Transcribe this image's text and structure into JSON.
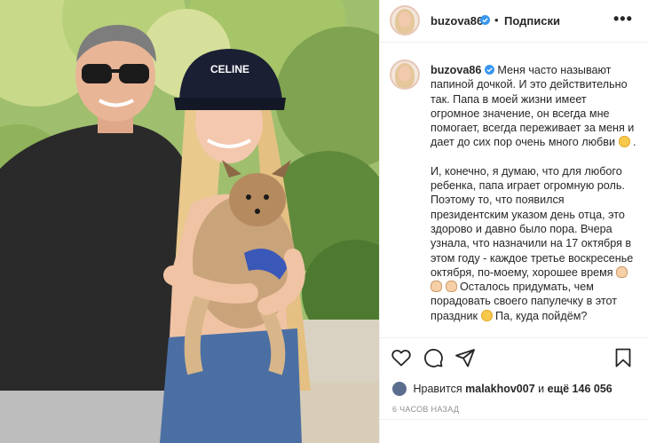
{
  "header": {
    "username": "buzova86",
    "separator": "•",
    "follow_label": "Подписки",
    "more_label": "•••"
  },
  "caption": {
    "username": "buzova86",
    "paragraph1": "Меня часто называют папиной дочкой. И это действительно так. Папа в моей жизни имеет огромное значение, он всегда мне помогает, всегда переживает за меня и дает до сих пор очень много любви",
    "paragraph1_end": ".",
    "paragraph2": "И, конечно, я думаю, что для любого ребенка, папа играет огромную роль. Поэтому то, что появился президентским указом день отца, это здорово и давно было пора. Вчера узнала, что назначили на 17 октября в этом году - каждое третье воскресенье октября, по-моему, хорошее время",
    "paragraph2_tail": "Осталось придумать, чем порадовать своего папулечку в этот праздник",
    "paragraph2_end": "Па, куда пойдём?"
  },
  "likes": {
    "prefix": "Нравится",
    "user": "malakhov007",
    "middle": "и",
    "count": "ещё 146 056"
  },
  "timestamp": "6 ЧАСОВ НАЗАД",
  "photo": {
    "cap_text": "CELINE"
  },
  "colors": {
    "verified": "#3897f0",
    "text": "#262626",
    "muted": "#8e8e8e",
    "border": "#efefef"
  },
  "icons": [
    "heart-icon",
    "comment-icon",
    "share-icon",
    "bookmark-icon",
    "verified-icon",
    "more-icon"
  ]
}
